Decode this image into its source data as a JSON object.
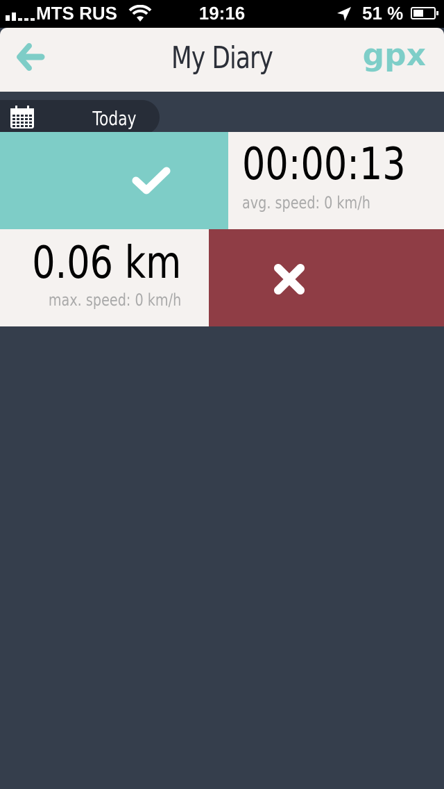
{
  "status_bar": {
    "carrier": "MTS RUS",
    "time": "19:16",
    "battery_percent": "51 %",
    "battery_level": 0.51,
    "signal_icon": "signal-bars-icon",
    "wifi_icon": "wifi-icon",
    "location_icon": "location-arrow-icon",
    "battery_icon": "battery-icon"
  },
  "nav": {
    "title": "My Diary",
    "back_icon": "back-arrow-icon",
    "export_label": "gpx"
  },
  "date_selector": {
    "icon": "calendar-icon",
    "label": "Today"
  },
  "track": {
    "duration": "00:00:13",
    "avg_speed": "avg. speed: 0 km/h",
    "distance": "0.06 km",
    "max_speed": "max. speed: 0 km/h"
  },
  "actions": {
    "accept_icon": "checkmark-icon",
    "reject_icon": "cross-icon"
  },
  "colors": {
    "accent": "#7ecdc7",
    "danger": "#8f3d45",
    "background": "#353e4c",
    "tile": "#f5f2f0"
  }
}
